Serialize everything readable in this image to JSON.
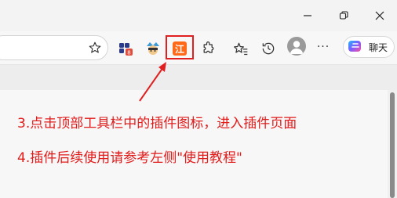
{
  "window": {
    "controls": [
      "minimize",
      "maximize",
      "close"
    ]
  },
  "toolbar": {
    "favorite_icon": "star-icon",
    "extensions": [
      {
        "name": "extension-badge-icon",
        "badge": "8"
      },
      {
        "name": "extension-avatar-icon"
      },
      {
        "name": "extension-jiang-icon",
        "label": "江"
      },
      {
        "name": "extensions-puzzle-icon"
      },
      {
        "name": "favorites-list-icon"
      },
      {
        "name": "history-icon"
      }
    ],
    "more_label": "···",
    "chat": {
      "label": "聊天"
    }
  },
  "instructions": {
    "line1": "3.点击顶部工具栏中的插件图标，进入插件页面",
    "line2": "4.插件后续使用请参考左侧\"使用教程\""
  },
  "colors": {
    "annotation_red": "#e02020",
    "ext_orange": "#ff6a1a"
  }
}
